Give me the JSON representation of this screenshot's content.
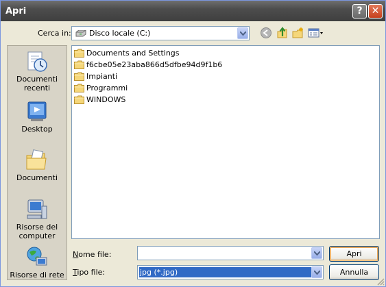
{
  "window": {
    "title": "Apri"
  },
  "toolbar": {
    "look_in_label": "Cerca in:",
    "look_in_value": "Disco locale (C:)"
  },
  "places": [
    {
      "label": "Documenti\nrecenti"
    },
    {
      "label": "Desktop"
    },
    {
      "label": "Documenti"
    },
    {
      "label": "Risorse del\ncomputer"
    },
    {
      "label": "Risorse di rete"
    }
  ],
  "files": [
    {
      "name": "Documents and Settings"
    },
    {
      "name": "f6cbe05e23aba866d5dfbe94d9f1b6"
    },
    {
      "name": "Impianti"
    },
    {
      "name": "Programmi"
    },
    {
      "name": "WINDOWS"
    }
  ],
  "form": {
    "filename_label": "Nome file:",
    "filename_value": "",
    "filetype_label": "Tipo file:",
    "filetype_value": "jpg (*.jpg)"
  },
  "buttons": {
    "open": "Apri",
    "cancel": "Annulla"
  },
  "colors": {
    "folder": "#F5D77A",
    "selection": "#316AC5"
  }
}
